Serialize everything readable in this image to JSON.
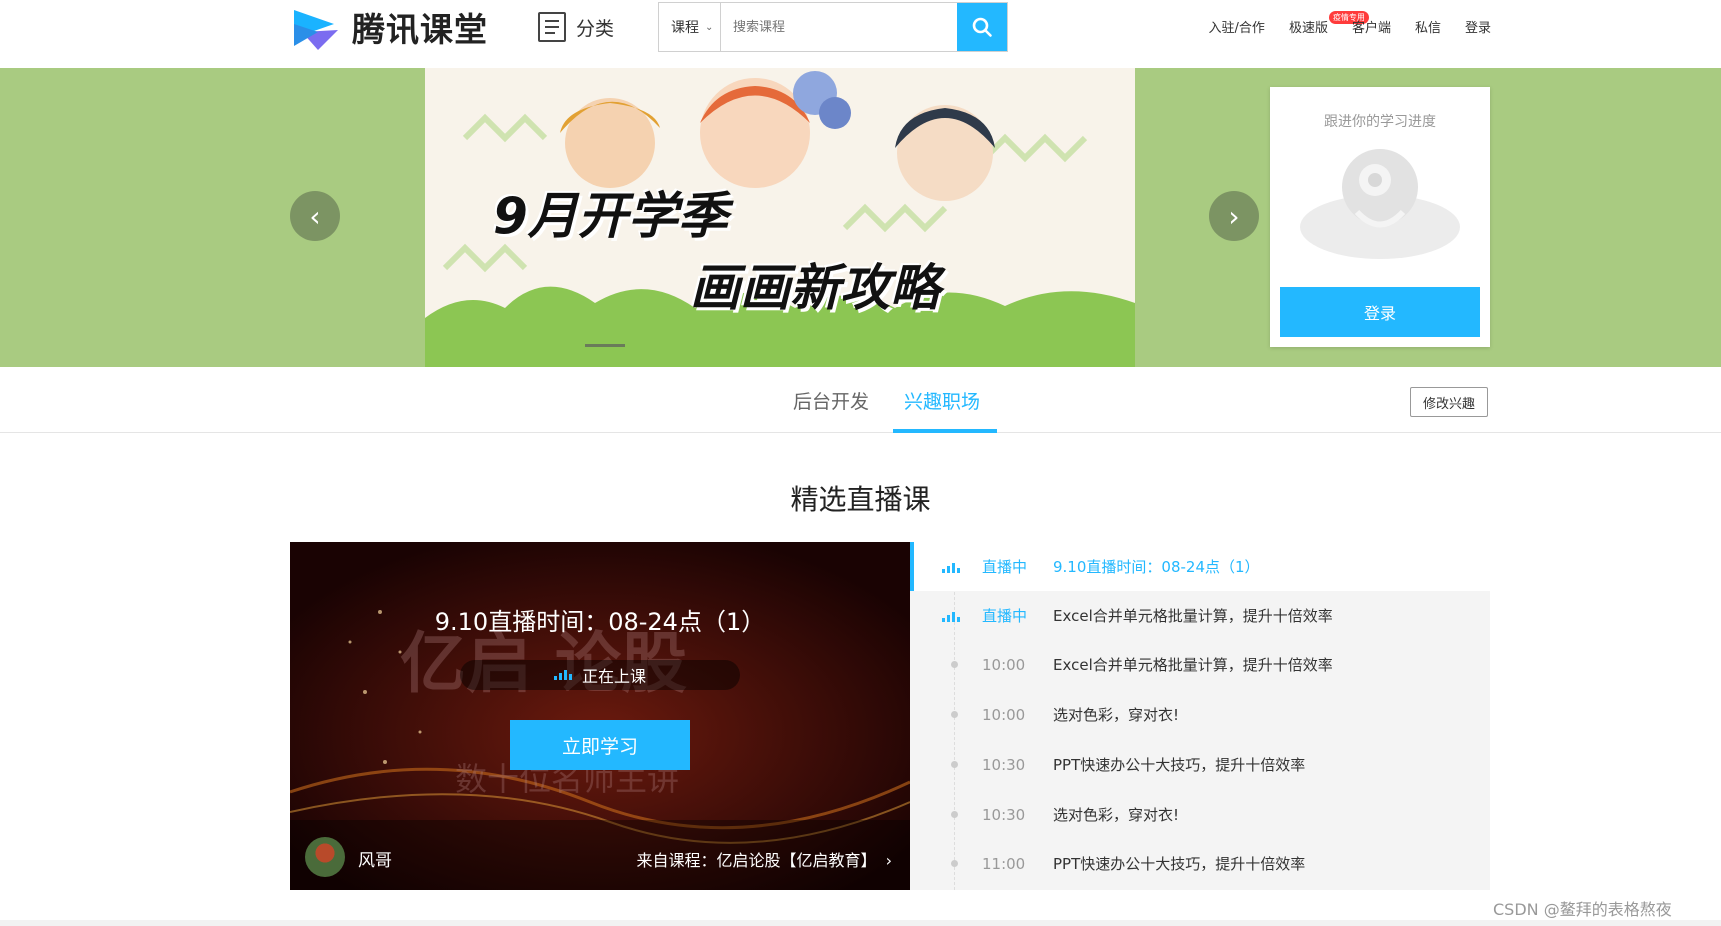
{
  "header": {
    "logo_text": "腾讯课堂",
    "category_label": "分类",
    "search": {
      "scope": "课程",
      "placeholder": "搜索课程"
    },
    "nav": [
      {
        "label": "入驻/合作"
      },
      {
        "label": "极速版",
        "badge": "疫情专用"
      },
      {
        "label": "客户端"
      },
      {
        "label": "私信"
      },
      {
        "label": "登录"
      }
    ]
  },
  "banner": {
    "headline_1": "9月开学季",
    "headline_2": "画画新攻略",
    "login_card": {
      "tip": "跟进你的学习进度",
      "button": "登录"
    }
  },
  "tabs": {
    "items": [
      "后台开发",
      "兴趣职场"
    ],
    "active": "兴趣职场",
    "edit_button": "修改兴趣"
  },
  "live_section": {
    "title": "精选直播课",
    "player": {
      "live_title": "9.10直播时间：08-24点（1）",
      "status": "正在上课",
      "study_button": "立即学习",
      "bg_text_1": "亿启 论股",
      "bg_text_2": "数十位名师主讲",
      "teacher": "风哥",
      "course": "来自课程：亿启论股【亿启教育】"
    },
    "schedule": [
      {
        "time": "直播中",
        "title": "9.10直播时间：08-24点（1）",
        "live": true
      },
      {
        "time": "直播中",
        "title": "Excel合并单元格批量计算，提升十倍效率",
        "live": true
      },
      {
        "time": "10:00",
        "title": "Excel合并单元格批量计算，提升十倍效率",
        "live": false
      },
      {
        "time": "10:00",
        "title": "选对色彩，穿对衣!",
        "live": false
      },
      {
        "time": "10:30",
        "title": "PPT快速办公十大技巧，提升十倍效率",
        "live": false
      },
      {
        "time": "10:30",
        "title": "选对色彩，穿对衣!",
        "live": false
      },
      {
        "time": "11:00",
        "title": "PPT快速办公十大技巧，提升十倍效率",
        "live": false
      }
    ]
  },
  "watermark": "CSDN @鳌拜的表格熬夜",
  "colors": {
    "accent": "#23b8ff",
    "banner_bg": "#a9cb81",
    "player_bg": "#2a0505"
  }
}
